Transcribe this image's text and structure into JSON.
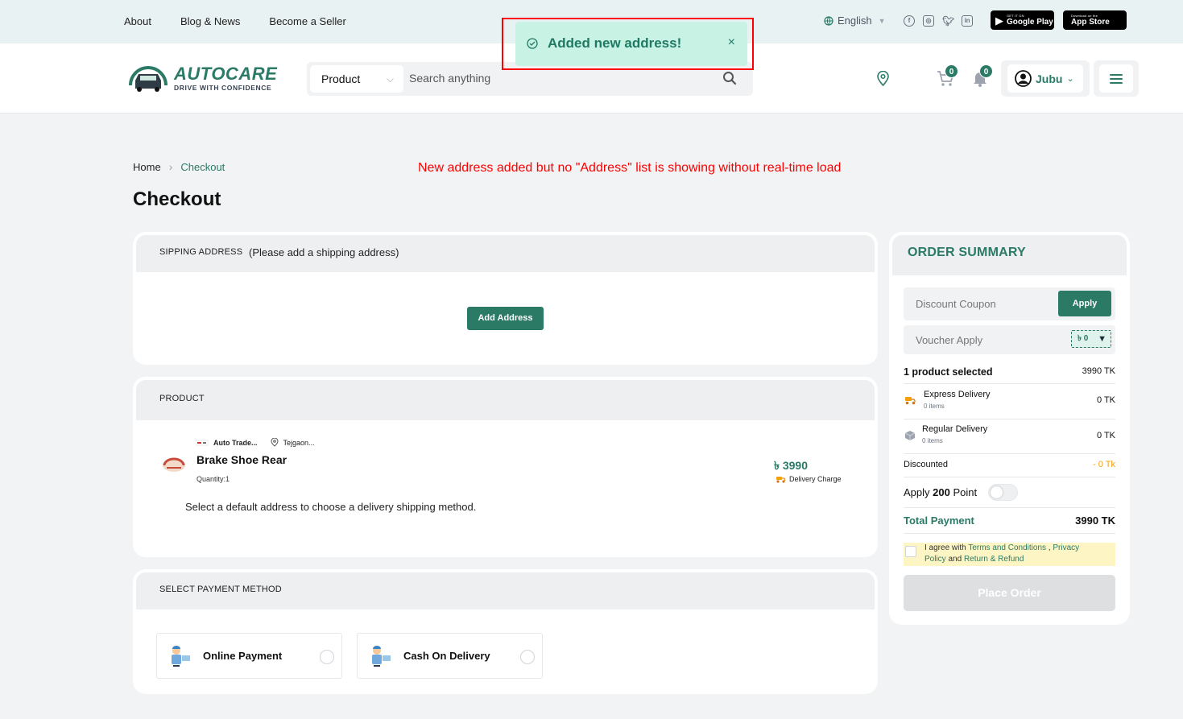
{
  "topbar": {
    "nav": [
      "About",
      "Blog & News",
      "Become a Seller"
    ],
    "language": "English",
    "socials": [
      "facebook-icon",
      "instagram-icon",
      "twitter-icon",
      "linkedin-icon"
    ],
    "google_play": {
      "small": "GET IT ON",
      "large": "Google Play"
    },
    "app_store": {
      "small": "Download on the",
      "large": "App Store"
    }
  },
  "header": {
    "logo_title": "AUTOCARE",
    "logo_sub": "DRIVE WITH CONFIDENCE",
    "search_category": "Product",
    "search_placeholder": "Search anything",
    "cart_count": "0",
    "notif_count": "0",
    "user_name": "Jubu"
  },
  "toast": {
    "message": "Added new address!",
    "close": "×"
  },
  "annotation": "New address added but no \"Address\" list is showing without real-time load",
  "breadcrumb": {
    "home": "Home",
    "current": "Checkout"
  },
  "page_title": "Checkout",
  "shipping": {
    "label": "SIPPING ADDRESS",
    "note": "(Please add a shipping address)",
    "add_button": "Add Address"
  },
  "product_section": {
    "label": "PRODUCT",
    "shop_name": "Auto Trade...",
    "shop_location": "Tejgaon...",
    "name": "Brake Shoe Rear",
    "quantity": "Quantity:1",
    "price": "৳ 3990",
    "delivery_label": "Delivery Charge",
    "note": "Select a default address to choose a delivery shipping method."
  },
  "payment": {
    "label": "SELECT PAYMENT METHOD",
    "options": [
      "Online Payment",
      "Cash On Delivery"
    ]
  },
  "summary": {
    "title": "ORDER SUMMARY",
    "coupon_placeholder": "Discount Coupon",
    "apply": "Apply",
    "voucher_placeholder": "Voucher Apply",
    "voucher_value": "৳ 0",
    "selected_label": "1 product selected",
    "selected_value": "3990 TK",
    "express_label": "Express Delivery",
    "express_items": "0 items",
    "express_value": "0 TK",
    "regular_label": "Regular Delivery",
    "regular_items": "0 items",
    "regular_value": "0 TK",
    "discounted_label": "Discounted",
    "discounted_value": "- 0 Tk",
    "points_pre": "Apply",
    "points_value": "200",
    "points_post": "Point",
    "total_label": "Total Payment",
    "total_value": "3990 TK",
    "agree_1": "I agree with",
    "agree_terms": "Terms and Conditions",
    "agree_comma": ",",
    "agree_privacy_a": "Privacy",
    "agree_privacy_b": "Policy",
    "agree_and": "and",
    "agree_refund": "Return & Refund",
    "place_order": "Place Order"
  },
  "colors": {
    "brand": "#2a7a66",
    "toast_bg": "#c7f2e4",
    "annotation": "#ff0000",
    "discount": "#f59e0b"
  }
}
